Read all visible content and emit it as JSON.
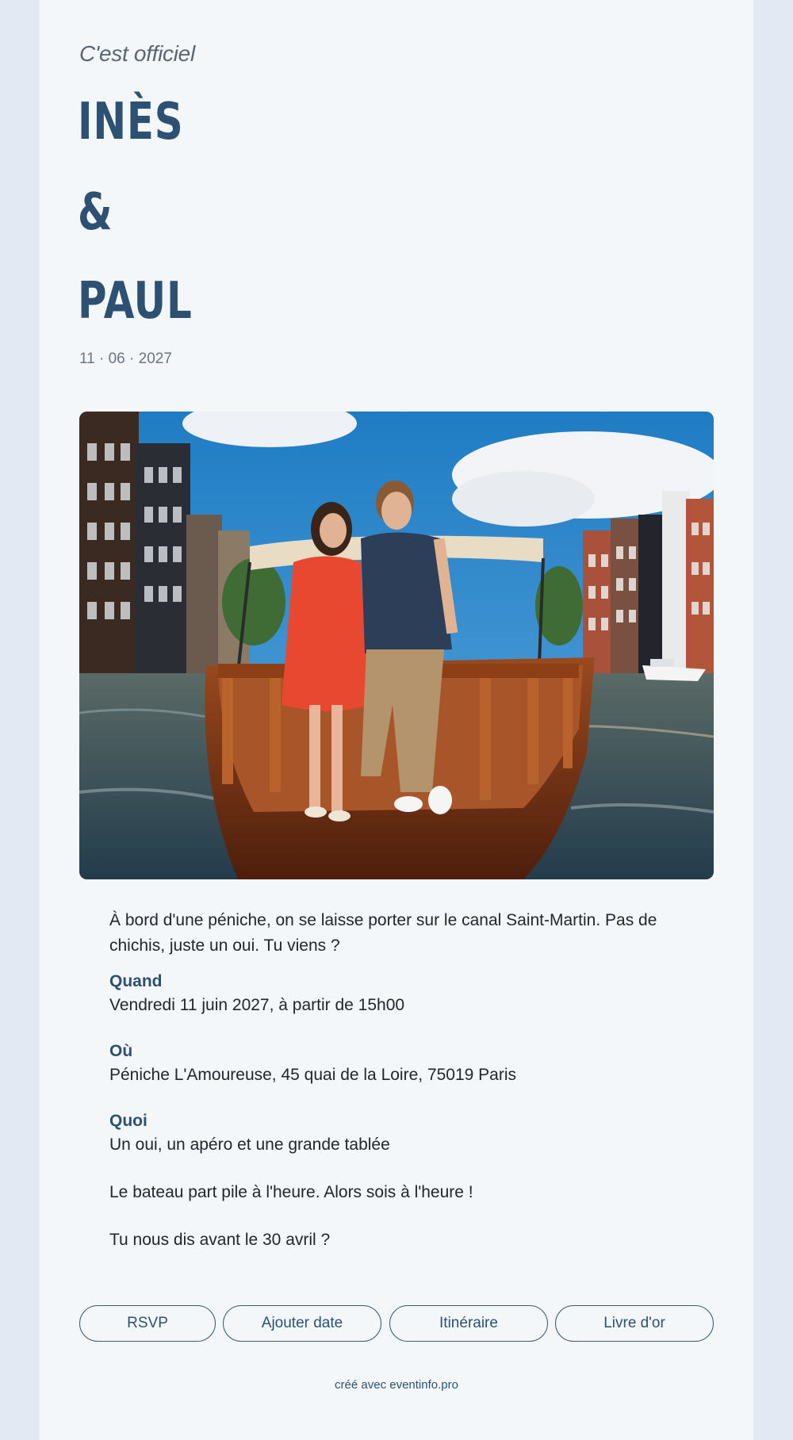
{
  "header": {
    "tagline": "C'est officiel",
    "name_first": "INÈS",
    "ampersand": "&",
    "name_second": "PAUL",
    "date": "11 · 06 · 2027"
  },
  "photo": {
    "icon": "couple-on-boat-photo"
  },
  "details": {
    "intro": "À bord d'une péniche, on se laisse porter sur le canal Saint-Martin. Pas de chichis, juste un oui. Tu viens ?",
    "when_label": "Quand",
    "when_value": "Vendredi 11 juin 2027, à partir de 15h00",
    "where_label": "Où",
    "where_value": "Péniche L'Amoureuse, 45 quai de la Loire, 75019 Paris",
    "what_label": "Quoi",
    "what_value": "Un oui, un apéro et une grande tablée",
    "note_1": "Le bateau part pile à l'heure. Alors sois à l'heure !",
    "note_2": "Tu nous dis avant le 30 avril ?"
  },
  "actions": {
    "rsvp": "RSVP",
    "add_date": "Ajouter date",
    "itinerary": "Itinéraire",
    "guestbook": "Livre d'or"
  },
  "footer": {
    "credit": "créé avec eventinfo.pro"
  },
  "colors": {
    "accent": "#2d5173",
    "background": "#f3f7fa",
    "outer_background": "#e2e9f2"
  }
}
